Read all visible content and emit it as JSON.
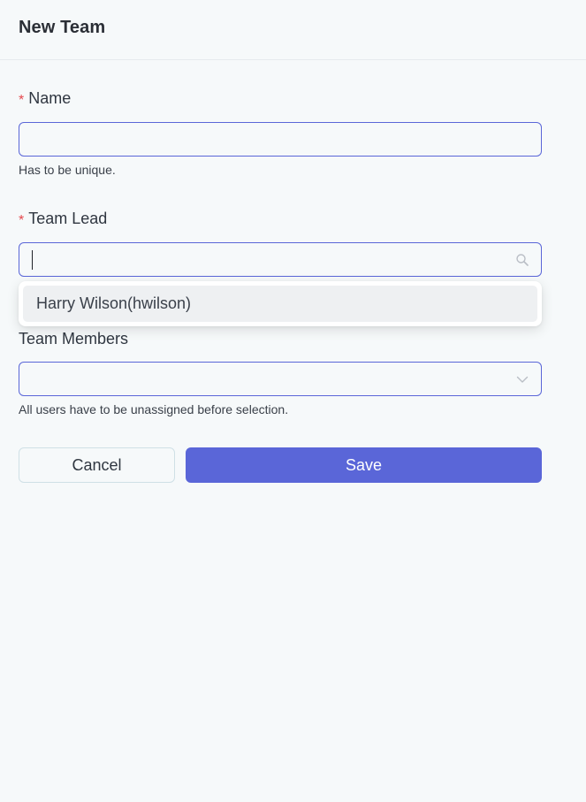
{
  "header": {
    "title": "New Team"
  },
  "form": {
    "name": {
      "required_mark": "*",
      "label": "Name",
      "value": "",
      "help": "Has to be unique."
    },
    "team_lead": {
      "required_mark": "*",
      "label": "Team Lead",
      "value": "",
      "icon": "search-icon",
      "options": [
        {
          "label": "Harry Wilson(hwilson)"
        }
      ]
    },
    "team_members": {
      "label": "Team Members",
      "value": "",
      "icon": "chevron-down-icon",
      "help": "All users have to be unassigned before selection."
    }
  },
  "actions": {
    "cancel_label": "Cancel",
    "save_label": "Save"
  },
  "colors": {
    "accent": "#5a66d8",
    "required": "#e5484d",
    "background": "#f6f9fa"
  }
}
